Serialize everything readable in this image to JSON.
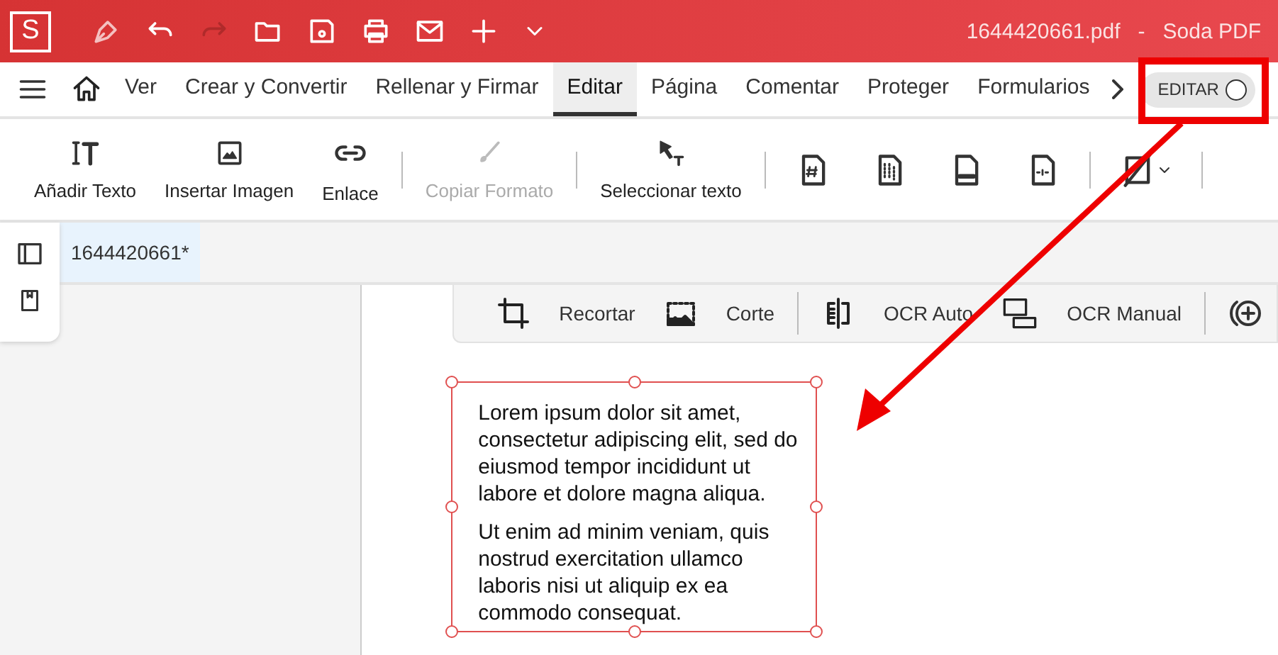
{
  "title_bar": {
    "logo": "S",
    "title": "1644420661.pdf   -   Soda PDF"
  },
  "menu_tabs": [
    {
      "label": "Ver",
      "selected": false
    },
    {
      "label": "Crear y Convertir",
      "selected": false
    },
    {
      "label": "Rellenar y Firmar",
      "selected": false
    },
    {
      "label": "Editar",
      "selected": true
    },
    {
      "label": "Página",
      "selected": false
    },
    {
      "label": "Comentar",
      "selected": false
    },
    {
      "label": "Proteger",
      "selected": false
    },
    {
      "label": "Formularios",
      "selected": false
    }
  ],
  "edit_toggle": {
    "label": "EDITAR",
    "on": false
  },
  "ribbon": [
    {
      "kind": "text",
      "label": "Añadir Texto",
      "disabled": false
    },
    {
      "kind": "text",
      "label": "Insertar Imagen",
      "disabled": false
    },
    {
      "kind": "text",
      "label": "Enlace",
      "disabled": false
    },
    {
      "kind": "separator"
    },
    {
      "kind": "text",
      "label": "Copiar Formato",
      "disabled": true
    },
    {
      "kind": "separator"
    },
    {
      "kind": "text",
      "label": "Seleccionar texto",
      "disabled": false
    },
    {
      "kind": "separator"
    },
    {
      "kind": "icon"
    },
    {
      "kind": "icon"
    },
    {
      "kind": "icon"
    },
    {
      "kind": "icon"
    },
    {
      "kind": "separator"
    },
    {
      "kind": "dropdown"
    },
    {
      "kind": "separator"
    }
  ],
  "document_tab": {
    "label": "1644420661*",
    "selected": true
  },
  "image_toolbar": [
    {
      "kind": "text",
      "label": "Recortar"
    },
    {
      "kind": "text",
      "label": "Corte"
    },
    {
      "kind": "separator"
    },
    {
      "kind": "text",
      "label": "OCR Auto"
    },
    {
      "kind": "text",
      "label": "OCR Manual"
    },
    {
      "kind": "separator"
    },
    {
      "kind": "icon"
    }
  ],
  "text_box": {
    "paragraphs": [
      "Lorem ipsum dolor sit amet, consectetur adipiscing elit, sed do eiusmod tempor incididunt ut labore et dolore magna aliqua.",
      "Ut enim ad minim veniam, quis nostrud exercitation ullamco laboris nisi ut aliquip ex ea commodo consequat."
    ]
  }
}
